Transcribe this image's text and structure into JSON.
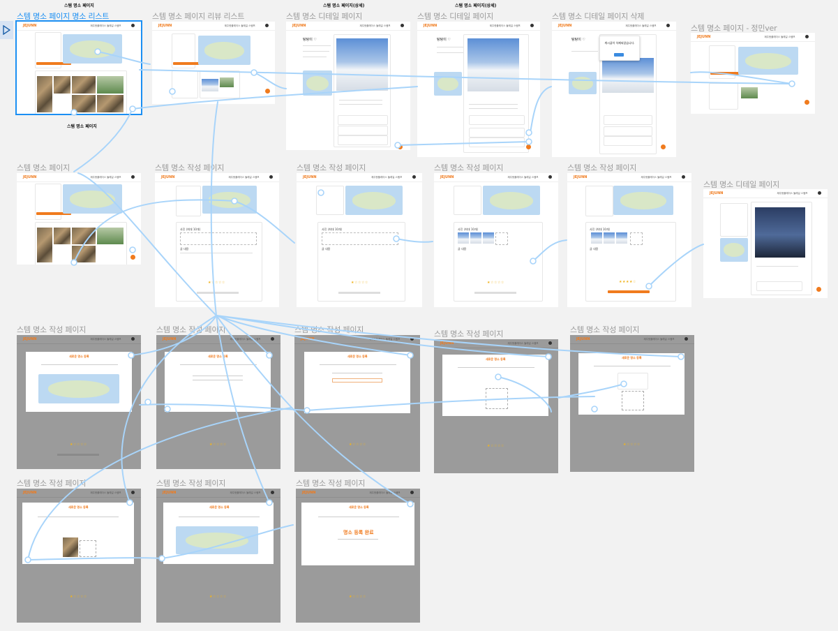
{
  "brand": {
    "logo": "JEJUNN",
    "accent": "#f07b1e",
    "selection": "#1b8ff3",
    "arrow": "#a8d4fa"
  },
  "header_nav": "제주핫플레이스   둘레길   스탬프",
  "notes": {
    "n1": "스탬 명소 페이지",
    "n2": "스탬 명소 페이지(상세)",
    "n3": "스탬 명소 페이지(상세)",
    "n4": "스탬 명소 페이지"
  },
  "frames": {
    "f1": "스템 명소 페이지 명소 리스트",
    "f2": "스템 명소 페이지 리뷰 리스트",
    "f3": "스템 명소 디테일 페이지",
    "f4": "스템 명소 디테일 페이지",
    "f5": "스템 명소 디테일 페이지 삭제",
    "f6": "스템 명소 페이지 - 정민ver",
    "r2_1": "스템 명소 페이지",
    "r2_2": "스템 명소 작성 페이지",
    "r2_3": "스템 명소 작성 페이지",
    "r2_4": "스템 명소 작성 페이지",
    "r2_5": "스템 명소 작성 페이지",
    "r2_6": "스템 명소 디테일 페이지",
    "r3_1": "스템 명소 작성 페이지",
    "r3_2": "스템 명소 작성 페이지",
    "r3_3": "스템 명소 작성 페이지",
    "r3_4": "스템 명소 작성 페이지",
    "r3_5": "스템 명소 작성 페이지",
    "r4_1": "스템 명소 작성 페이지",
    "r4_2": "스템 명소 작성 페이지",
    "r4_3": "스템 명소 작성 페이지"
  },
  "content": {
    "detail_title": "탕탕이 ♡",
    "delete_popup": "게시글이 삭제되었습니다.",
    "modal_title": "새로운 명소 등록",
    "done_title": "명소 등록 완료",
    "stars": "★☆☆☆☆",
    "stars_full": "★★★★☆",
    "section_photo": "사진 (최대 10개)",
    "section_text": "글 내용"
  }
}
